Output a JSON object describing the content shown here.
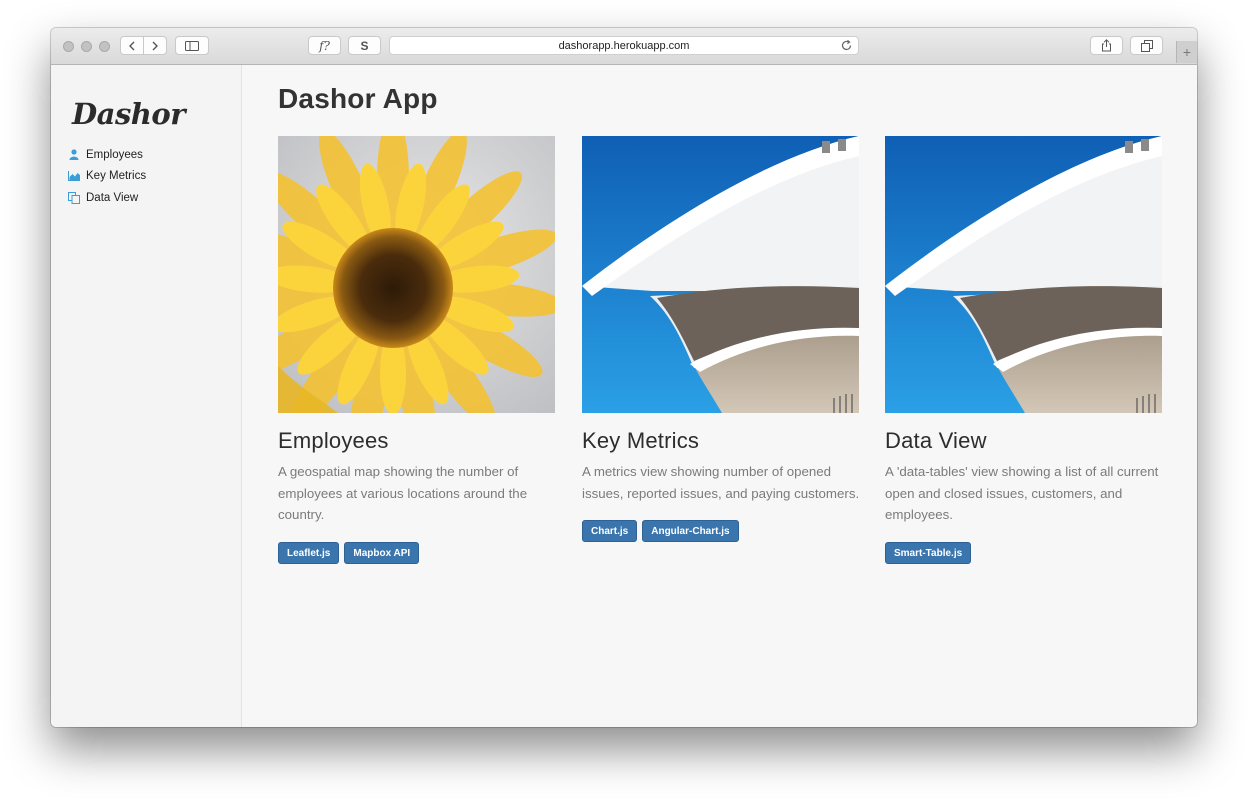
{
  "browser": {
    "url": "dashorapp.herokuapp.com",
    "btn_f": "f?",
    "btn_s": "S",
    "new_tab": "+"
  },
  "sidebar": {
    "logo": "Dashor",
    "items": [
      {
        "label": "Employees",
        "icon": "user-icon"
      },
      {
        "label": "Key Metrics",
        "icon": "area-chart-icon"
      },
      {
        "label": "Data View",
        "icon": "copy-icon"
      }
    ]
  },
  "main": {
    "title": "Dashor App",
    "cards": [
      {
        "title": "Employees",
        "description": "A geospatial map showing the number of employees at various locations around the country.",
        "image": "sunflower-photo",
        "tags": [
          "Leaflet.js",
          "Mapbox API"
        ]
      },
      {
        "title": "Key Metrics",
        "description": "A metrics view showing number of opened issues, reported issues, and paying customers.",
        "image": "architecture-photo",
        "tags": [
          "Chart.js",
          "Angular-Chart.js"
        ]
      },
      {
        "title": "Data View",
        "description": "A 'data-tables' view showing a list of all current open and closed issues, customers, and employees.",
        "image": "architecture-photo",
        "tags": [
          "Smart-Table.js"
        ]
      }
    ]
  },
  "colors": {
    "tag_bg": "#3a75ad",
    "icon_accent": "#3a9fd8",
    "page_bg": "#f7f7f7"
  }
}
